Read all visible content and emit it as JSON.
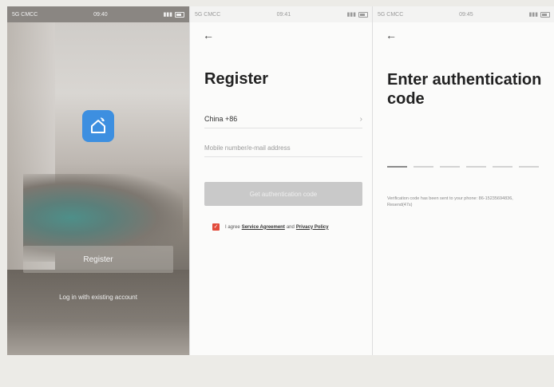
{
  "screens": {
    "welcome": {
      "status": {
        "carrier": "5G CMCC",
        "time": "09:40",
        "battery": ""
      },
      "icon": "home-wifi-icon",
      "register_label": "Register",
      "login_label": "Log in with existing account"
    },
    "register": {
      "status": {
        "carrier": "5G CMCC",
        "time": "09:41",
        "battery": ""
      },
      "back_icon": "back-arrow-icon",
      "title": "Register",
      "country": "China +86",
      "phone_placeholder": "Mobile number/e-mail address",
      "get_code_label": "Get authentication code",
      "agree_prefix": "I agree",
      "service_link": "Service Agreement",
      "agree_and": "and",
      "privacy_link": "Privacy Policy",
      "agree_checked": true
    },
    "auth": {
      "status": {
        "carrier": "5G CMCC",
        "time": "09:45",
        "battery": ""
      },
      "back_icon": "back-arrow-icon",
      "title": "Enter authentication code",
      "verify_note": "Verification code has been sent to your phone: 86-15235694836, Resend(47s)",
      "code_slot_count": 6
    }
  },
  "colors": {
    "app_blue": "#3d8fe0",
    "checkbox_red": "#e24b3b",
    "disabled_button": "#c9c9c9"
  }
}
